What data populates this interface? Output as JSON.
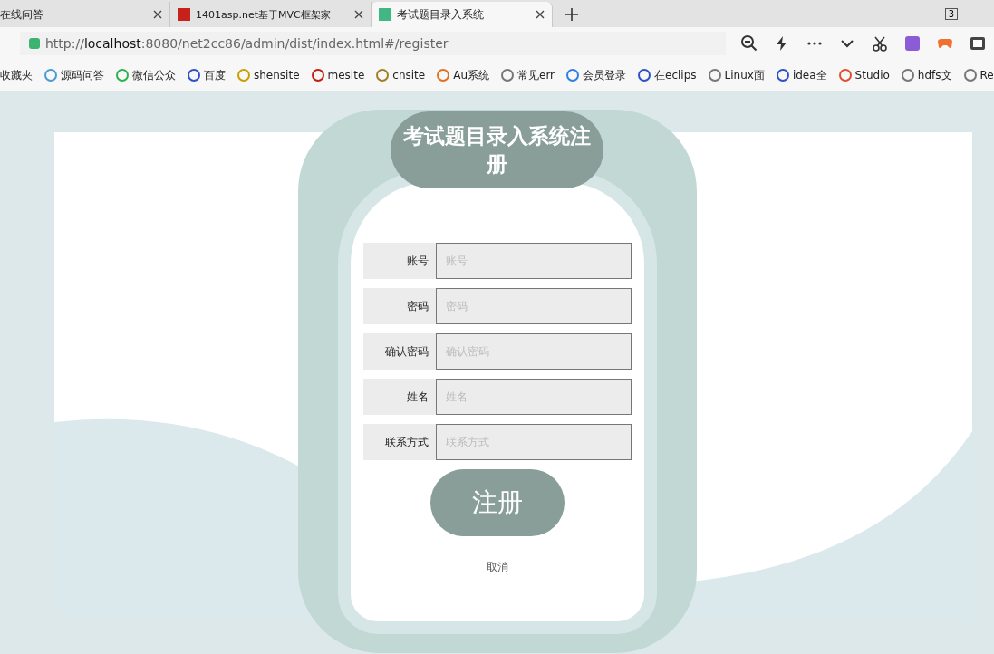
{
  "browser": {
    "tabs": [
      {
        "title": "在线问答",
        "selected": false
      },
      {
        "title": "1401asp.net基于MVC框架家",
        "selected": false
      },
      {
        "title": "考试题目录入系统",
        "selected": true
      }
    ],
    "tab_count": "3",
    "address": "http://**localhost**:8080/net2cc86/admin/dist/index.html#/register",
    "bookmarks": [
      "收藏夹",
      "源码问答",
      "微信公众",
      "百度",
      "shensite",
      "mesite",
      "cnsite",
      "Au系统",
      "常见err",
      "会员登录",
      "在eclips",
      "Linux面",
      "idea全",
      "Studio",
      "hdfs文",
      "Re"
    ]
  },
  "form": {
    "title": "考试题目录入系统注册",
    "fields": [
      {
        "label": "账号",
        "placeholder": "账号"
      },
      {
        "label": "密码",
        "placeholder": "密码"
      },
      {
        "label": "确认密码",
        "placeholder": "确认密码"
      },
      {
        "label": "姓名",
        "placeholder": "姓名"
      },
      {
        "label": "联系方式",
        "placeholder": "联系方式"
      }
    ],
    "submit": "注册",
    "cancel": "取消"
  }
}
